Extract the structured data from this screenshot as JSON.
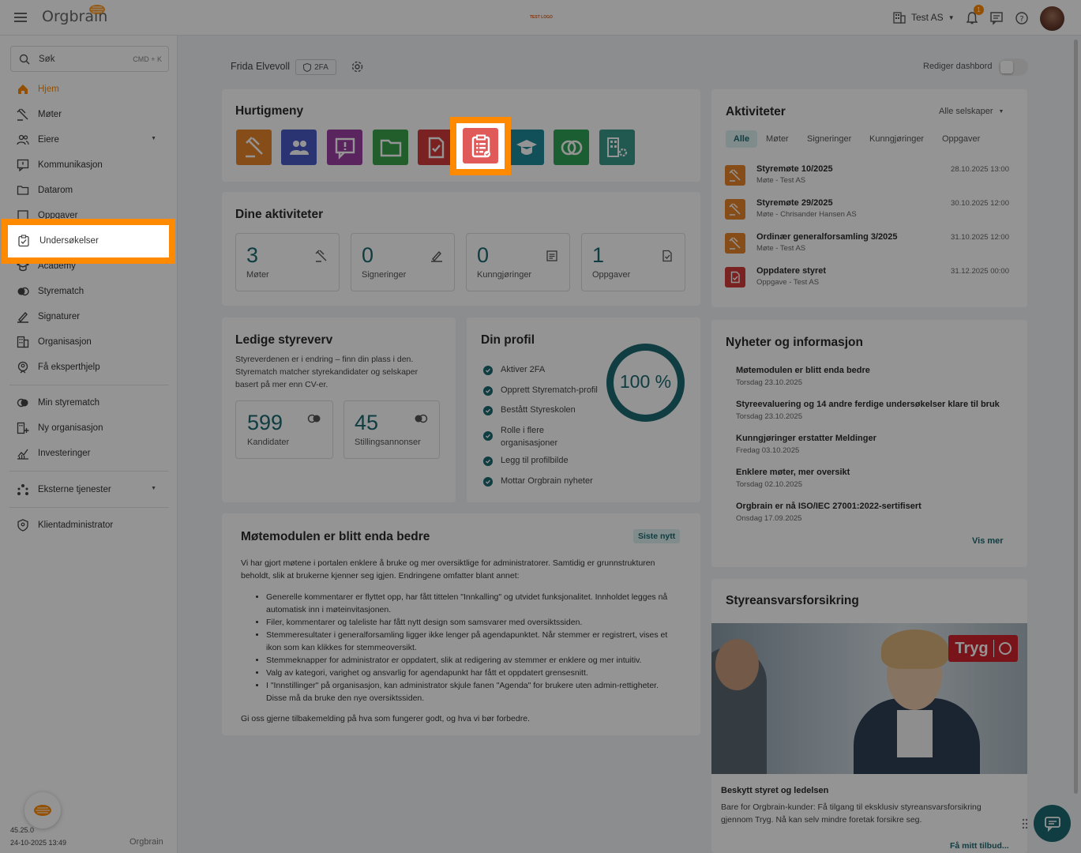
{
  "app": {
    "brand": "Orgbrain",
    "center_logo": "TEST LOGO",
    "company": "Test AS",
    "notif_count": "1"
  },
  "search": {
    "placeholder": "Søk",
    "shortcut": "CMD + K"
  },
  "sidebar": {
    "items": [
      {
        "label": "Hjem",
        "icon": "home-icon"
      },
      {
        "label": "Møter",
        "icon": "gavel-icon"
      },
      {
        "label": "Eiere",
        "icon": "people-icon"
      },
      {
        "label": "Kommunikasjon",
        "icon": "message-icon"
      },
      {
        "label": "Datarom",
        "icon": "folder-icon"
      },
      {
        "label": "Oppgaver",
        "icon": "task-icon"
      },
      {
        "label": "Undersøkelser",
        "icon": "survey-icon"
      },
      {
        "label": "Academy",
        "icon": "academy-icon"
      },
      {
        "label": "Styrematch",
        "icon": "match-icon"
      },
      {
        "label": "Signaturer",
        "icon": "signature-icon"
      },
      {
        "label": "Organisasjon",
        "icon": "building-icon"
      },
      {
        "label": "Få eksperthjelp",
        "icon": "expert-icon"
      }
    ],
    "secondary": [
      {
        "label": "Min styrematch",
        "icon": "toggle-icon"
      },
      {
        "label": "Ny organisasjon",
        "icon": "new-building-icon"
      },
      {
        "label": "Investeringer",
        "icon": "chart-icon"
      }
    ],
    "external": "Eksterne tjenester",
    "admin": "Klientadministrator",
    "version": "45.25.0",
    "timestamp": "24-10-2025 13:49",
    "footer_brand": "Orgbrain"
  },
  "header": {
    "user": "Frida Elvevoll",
    "badge_2fa": "2FA",
    "edit_dashboard": "Rediger dashbord"
  },
  "quickmenu": {
    "title": "Hurtigmeny",
    "items": [
      {
        "name": "meetings",
        "color": "#e8862a"
      },
      {
        "name": "owners",
        "color": "#4a5bc4"
      },
      {
        "name": "communication",
        "color": "#9b3fa3"
      },
      {
        "name": "dataroom",
        "color": "#3aa24a"
      },
      {
        "name": "tasks",
        "color": "#d23a3a"
      },
      {
        "name": "surveys",
        "color": "#e05a5a"
      },
      {
        "name": "academy",
        "color": "#1f8a9a"
      },
      {
        "name": "styrematch",
        "color": "#2ea356"
      },
      {
        "name": "organisation",
        "color": "#3a9a8a"
      }
    ]
  },
  "activities_card": {
    "title": "Dine aktiviteter",
    "stats": [
      {
        "value": "3",
        "label": "Møter"
      },
      {
        "value": "0",
        "label": "Signeringer"
      },
      {
        "value": "0",
        "label": "Kunngjøringer"
      },
      {
        "value": "1",
        "label": "Oppgaver"
      }
    ]
  },
  "board_jobs": {
    "title": "Ledige styreverv",
    "text": "Styreverdenen er i endring – finn din plass i den. Styrematch matcher styrekandidater og selskaper basert på mer enn CV-er.",
    "stats": [
      {
        "value": "599",
        "label": "Kandidater"
      },
      {
        "value": "45",
        "label": "Stillingsannonser"
      }
    ]
  },
  "profile": {
    "title": "Din profil",
    "percent": "100 %",
    "progress": 1.0,
    "items": [
      "Aktiver 2FA",
      "Opprett Styrematch-profil",
      "Bestått Styreskolen",
      "Rolle i flere organisasjoner",
      "Legg til profilbilde",
      "Mottar Orgbrain nyheter"
    ]
  },
  "article": {
    "title": "Møtemodulen er blitt enda bedre",
    "tag": "Siste nytt",
    "intro": "Vi har gjort møtene i portalen enklere å bruke og mer oversiktlige for administratorer. Samtidig er grunnstrukturen beholdt, slik at brukerne kjenner seg igjen. Endringene omfatter blant annet:",
    "bullets": [
      "Generelle kommentarer er flyttet opp, har fått tittelen \"Innkalling\" og utvidet funksjonalitet. Innholdet legges nå automatisk inn i møteinvitasjonen.",
      "Filer, kommentarer og taleliste har fått nytt design som samsvarer med oversiktssiden.",
      "Stemmeresultater i generalforsamling ligger ikke lenger på agendapunktet. Når stemmer er registrert, vises et ikon som kan klikkes for stemmeoversikt.",
      "Stemmeknapper for administrator er oppdatert, slik at redigering av stemmer er enklere og mer intuitiv.",
      "Valg av kategori, varighet og ansvarlig for agendapunkt har fått et oppdatert grensesnitt.",
      "I \"Innstillinger\" på organisasjon, kan administrator skjule fanen \"Agenda\" for brukere uten admin-rettigheter. Disse må da bruke den nye oversiktssiden."
    ],
    "outro": "Gi oss gjerne tilbakemelding på hva som fungerer godt, og hva vi bør forbedre."
  },
  "aktiviteter": {
    "title": "Aktiviteter",
    "filter": "Alle selskaper",
    "tabs": [
      "Alle",
      "Møter",
      "Signeringer",
      "Kunngjøringer",
      "Oppgaver"
    ],
    "rows": [
      {
        "title": "Styremøte 10/2025",
        "sub": "Møte - Test AS",
        "date": "28.10.2025 13:00",
        "color": "#e8862a"
      },
      {
        "title": "Styremøte 29/2025",
        "sub": "Møte - Chrisander Hansen AS",
        "date": "30.10.2025 12:00",
        "color": "#e8862a"
      },
      {
        "title": "Ordinær generalforsamling 3/2025",
        "sub": "Møte - Test AS",
        "date": "31.10.2025 12:00",
        "color": "#e8862a"
      },
      {
        "title": "Oppdatere styret",
        "sub": "Oppgave - Test AS",
        "date": "31.12.2025 00:00",
        "color": "#d23a3a"
      }
    ]
  },
  "news": {
    "title": "Nyheter og informasjon",
    "items": [
      {
        "title": "Møtemodulen er blitt enda bedre",
        "date": "Torsdag 23.10.2025"
      },
      {
        "title": "Styreevaluering og 14 andre ferdige undersøkelser klare til bruk",
        "date": "Torsdag 23.10.2025"
      },
      {
        "title": "Kunngjøringer erstatter Meldinger",
        "date": "Fredag 03.10.2025"
      },
      {
        "title": "Enklere møter, mer oversikt",
        "date": "Torsdag 02.10.2025"
      },
      {
        "title": "Orgbrain er nå ISO/IEC 27001:2022-sertifisert",
        "date": "Onsdag 17.09.2025"
      }
    ],
    "more": "Vis mer"
  },
  "insurance": {
    "title": "Styreansvarsforsikring",
    "logo": "Tryg",
    "heading": "Beskytt styret og ledelsen",
    "text": "Bare for Orgbrain-kunder: Få tilgang til eksklusiv styreansvarsforsikring gjennom Tryg. Nå kan selv mindre foretak forsikre seg.",
    "cta": "Få mitt tilbud..."
  },
  "colors": {
    "accent": "#ff8a00",
    "teal": "#1a6a72"
  }
}
